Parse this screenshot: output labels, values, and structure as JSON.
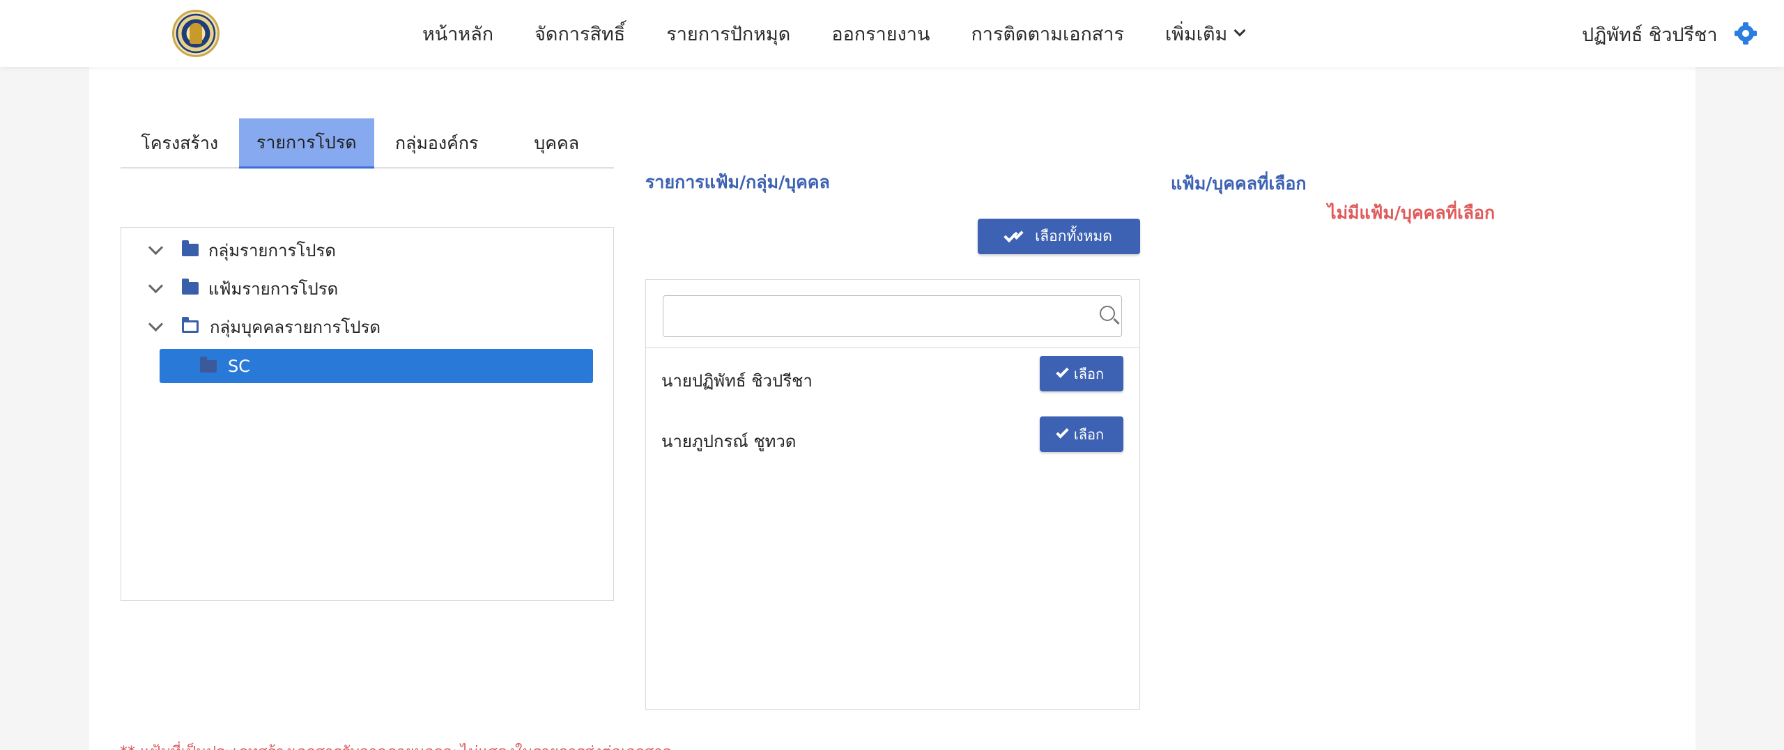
{
  "navbar": {
    "menu": [
      "หน้าหลัก",
      "จัดการสิทธิ์",
      "รายการปักหมุด",
      "ออกรายงาน",
      "การติดตามเอกสาร",
      "เพิ่มเติม"
    ],
    "user_name": "ปฏิพัทธ์ ชิวปรีชา"
  },
  "tabs": [
    {
      "label": "โครงสร้าง",
      "active": false
    },
    {
      "label": "รายการโปรด",
      "active": true
    },
    {
      "label": "กลุ่มองค์กร",
      "active": false
    },
    {
      "label": "บุคคล",
      "active": false
    }
  ],
  "tree": {
    "items": [
      "กลุ่มรายการโปรด",
      "แฟ้มรายการโปรด",
      "กลุ่มบุคคลรายการโปรด"
    ],
    "selected_child": "SC"
  },
  "middle": {
    "title": "รายการแฟ้ม/กลุ่ม/บุคคล",
    "select_all_label": "เลือกทั้งหมด",
    "search": {
      "value": "",
      "placeholder": ""
    },
    "rows": [
      {
        "name": "นายปฏิพัทธ์ ชิวปรีชา",
        "button": "เลือก"
      },
      {
        "name": "นายภูปกรณ์ ชูทวด",
        "button": "เลือก"
      }
    ]
  },
  "right": {
    "title": "แฟ้ม/บุคคลที่เลือก",
    "empty_text": "ไม่มีแฟ้ม/บุคคลที่เลือก"
  },
  "footnote": "** แฟ้มที่เป็นประเภทสร้างเอกสารรับจากภายนอกจะไม่แสดงในรายการส่งต่อเอกสาร",
  "colors": {
    "primary": "#3d62b3",
    "tab_active": "#87a9f0",
    "tree_selected": "#2979d8",
    "alert": "#e05a5a",
    "settings": "#2b7de0"
  }
}
